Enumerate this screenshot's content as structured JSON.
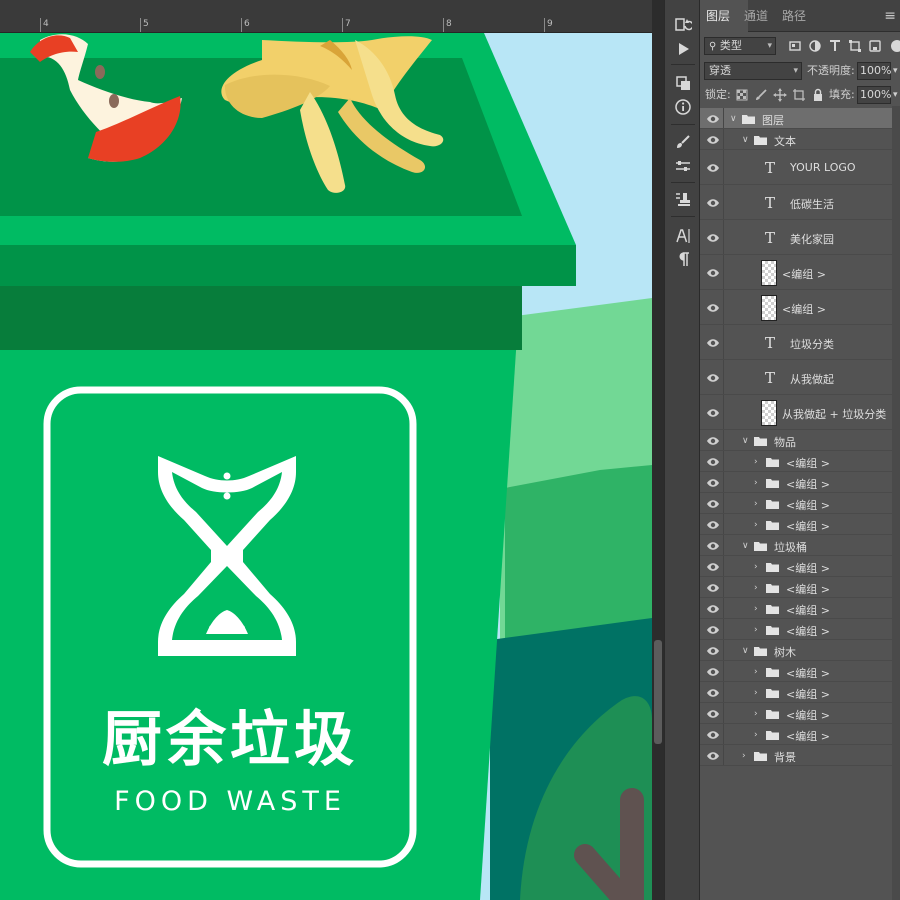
{
  "canvas": {
    "ruler_numbers": [
      "4",
      "5",
      "6",
      "7",
      "8",
      "9"
    ],
    "sign_title": "厨余垃圾",
    "sign_subtitle": "FOOD WASTE",
    "colors": {
      "sky": "#b8e6f6",
      "bin_green": "#00bb63",
      "bin_dark": "#077d3b",
      "lid_green": "#009348",
      "hill_light": "#72d895",
      "hill_mid": "#2fb366",
      "hill_dark": "#007264",
      "tree": "#1e8f55",
      "trunk": "#5f5250"
    }
  },
  "toolstrip": {
    "icons": [
      "history-icon",
      "play-icon",
      "3d-icon",
      "info-icon",
      "brush-icon",
      "adjust-icon",
      "stamp-icon",
      "character-icon",
      "paragraph-icon"
    ]
  },
  "panel": {
    "tabs": [
      {
        "label": "图层",
        "active": true
      },
      {
        "label": "通道",
        "active": false
      },
      {
        "label": "路径",
        "active": false
      }
    ],
    "filter": {
      "value": "类型"
    },
    "blend": {
      "value": "穿透"
    },
    "opacity": {
      "label": "不透明度:",
      "value": "100%"
    },
    "lock": {
      "label": "锁定:"
    },
    "fill": {
      "label": "填充:",
      "value": "100%"
    },
    "layers": [
      {
        "name": "图层",
        "kind": "group",
        "level": 0,
        "expanded": true,
        "selected": true
      },
      {
        "name": "文本",
        "kind": "group",
        "level": 1,
        "expanded": true
      },
      {
        "name": "YOUR LOGO",
        "kind": "text",
        "level": 2
      },
      {
        "name": "低碳生活",
        "kind": "text",
        "level": 2
      },
      {
        "name": "美化家园",
        "kind": "text",
        "level": 2
      },
      {
        "name": "<编组 >",
        "kind": "thumb",
        "level": 2
      },
      {
        "name": "<编组 >",
        "kind": "thumb",
        "level": 2
      },
      {
        "name": "垃圾分类",
        "kind": "text",
        "level": 2
      },
      {
        "name": "从我做起",
        "kind": "text",
        "level": 2
      },
      {
        "name": "从我做起 + 垃圾分类",
        "kind": "thumb",
        "level": 2
      },
      {
        "name": "物品",
        "kind": "group",
        "level": 1,
        "expanded": true
      },
      {
        "name": "<编组 >",
        "kind": "group",
        "level": 2,
        "expanded": false
      },
      {
        "name": "<编组 >",
        "kind": "group",
        "level": 2,
        "expanded": false
      },
      {
        "name": "<编组 >",
        "kind": "group",
        "level": 2,
        "expanded": false
      },
      {
        "name": "<编组 >",
        "kind": "group",
        "level": 2,
        "expanded": false
      },
      {
        "name": "垃圾桶",
        "kind": "group",
        "level": 1,
        "expanded": true
      },
      {
        "name": "<编组 >",
        "kind": "group",
        "level": 2,
        "expanded": false
      },
      {
        "name": "<编组 >",
        "kind": "group",
        "level": 2,
        "expanded": false
      },
      {
        "name": "<编组 >",
        "kind": "group",
        "level": 2,
        "expanded": false
      },
      {
        "name": "<编组 >",
        "kind": "group",
        "level": 2,
        "expanded": false
      },
      {
        "name": "树木",
        "kind": "group",
        "level": 1,
        "expanded": true
      },
      {
        "name": "<编组 >",
        "kind": "group",
        "level": 2,
        "expanded": false
      },
      {
        "name": "<编组 >",
        "kind": "group",
        "level": 2,
        "expanded": false
      },
      {
        "name": "<编组 >",
        "kind": "group",
        "level": 2,
        "expanded": false
      },
      {
        "name": "<编组 >",
        "kind": "group",
        "level": 2,
        "expanded": false
      },
      {
        "name": "背景",
        "kind": "group",
        "level": 1,
        "expanded": false
      }
    ]
  }
}
